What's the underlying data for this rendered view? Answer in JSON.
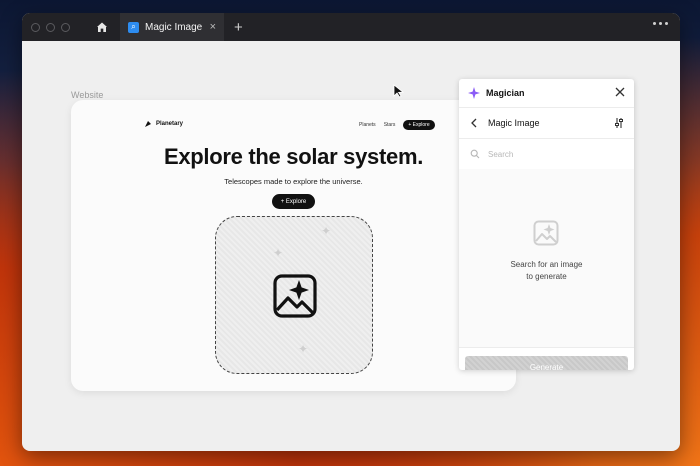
{
  "browser": {
    "tab": {
      "title": "Magic Image",
      "favicon": "magnifier-favicon"
    },
    "new_tab_label": "+"
  },
  "canvas": {
    "frame_label": "Website"
  },
  "website": {
    "logo_text": "Planetary",
    "nav": {
      "planets": "Planets",
      "stars": "Stars",
      "cta": "+ Explore"
    },
    "headline": "Explore the solar system.",
    "subheadline": "Telescopes made to explore the universe.",
    "button": "+ Explore"
  },
  "panel": {
    "title": "Magician",
    "subtitle": "Magic Image",
    "search": {
      "placeholder": "Search",
      "value": ""
    },
    "empty_state": {
      "line1": "Search for an image",
      "line2": "to generate"
    },
    "generate_label": "Generate",
    "accent_color": "#8b5cf6"
  }
}
